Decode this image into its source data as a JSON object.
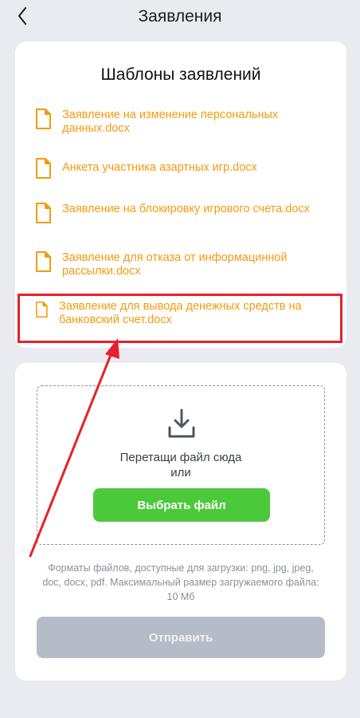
{
  "header": {
    "title": "Заявления",
    "back_icon": "chevron-left-icon"
  },
  "templates": {
    "title": "Шаблоны заявлений",
    "items": [
      {
        "label": "Заявление на изменение персональных данных.docx"
      },
      {
        "label": "Анкета участника азартных игр.docx"
      },
      {
        "label": "Заявление на блокировку игрового счета.docx"
      },
      {
        "label": "Заявление для отказа от информацинной рассылки.docx"
      },
      {
        "label": "Заявление для вывода денежных средств на банковский счет.docx"
      }
    ]
  },
  "upload": {
    "icon": "download-icon",
    "drop_line1": "Перетащи файл сюда",
    "drop_line2": "или",
    "select_button": "Выбрать файл",
    "formats_note": "Форматы файлов, доступные для загрузки: png, jpg, jpeg, doc, docx, pdf. Максимальный размер загружаемого файла: 10 Мб",
    "submit_button": "Отправить"
  },
  "colors": {
    "accent_orange": "#f59a0d",
    "green_button": "#4cc93b",
    "disabled_button": "#b6bcc7",
    "annotation_red": "#e8202a",
    "background": "#e9ebf0"
  }
}
